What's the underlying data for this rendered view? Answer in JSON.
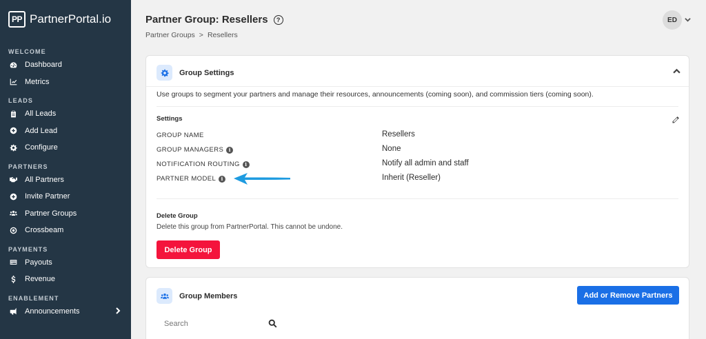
{
  "app": {
    "logo_text": "PP",
    "brand_name": "PartnerPortal.io"
  },
  "sidebar": {
    "sections": [
      {
        "label": "WELCOME",
        "items": [
          {
            "label": "Dashboard",
            "icon": "dashboard-gauge-icon"
          },
          {
            "label": "Metrics",
            "icon": "chart-line-icon"
          }
        ]
      },
      {
        "label": "LEADS",
        "items": [
          {
            "label": "All Leads",
            "icon": "clipboard-icon"
          },
          {
            "label": "Add Lead",
            "icon": "plus-circle-icon"
          },
          {
            "label": "Configure",
            "icon": "gear-icon"
          }
        ]
      },
      {
        "label": "PARTNERS",
        "items": [
          {
            "label": "All Partners",
            "icon": "handshake-icon"
          },
          {
            "label": "Invite Partner",
            "icon": "plus-circle-icon"
          },
          {
            "label": "Partner Groups",
            "icon": "users-icon"
          },
          {
            "label": "Crossbeam",
            "icon": "target-icon"
          }
        ]
      },
      {
        "label": "PAYMENTS",
        "items": [
          {
            "label": "Payouts",
            "icon": "credit-card-icon"
          },
          {
            "label": "Revenue",
            "icon": "dollar-icon"
          }
        ]
      },
      {
        "label": "ENABLEMENT",
        "items": [
          {
            "label": "Announcements",
            "icon": "megaphone-icon",
            "has_chevron": true
          }
        ]
      }
    ]
  },
  "header": {
    "title": "Partner Group: Resellers",
    "breadcrumb": [
      "Partner Groups",
      ">",
      "Resellers"
    ],
    "user_initials": "ED"
  },
  "group_settings": {
    "title": "Group Settings",
    "description": "Use groups to segment your partners and manage their resources, announcements (coming soon), and commission tiers (coming soon).",
    "settings_label": "Settings",
    "fields": [
      {
        "label": "GROUP NAME",
        "value": "Resellers",
        "has_info": false
      },
      {
        "label": "GROUP MANAGERS",
        "value": "None",
        "has_info": true
      },
      {
        "label": "NOTIFICATION ROUTING",
        "value": "Notify all admin and staff",
        "has_info": true
      },
      {
        "label": "PARTNER MODEL",
        "value": "Inherit (Reseller)",
        "has_info": true
      }
    ],
    "delete_title": "Delete Group",
    "delete_description": "Delete this group from PartnerPortal. This cannot be undone.",
    "delete_button": "Delete Group"
  },
  "group_members": {
    "title": "Group Members",
    "add_remove_button": "Add or Remove Partners",
    "search_placeholder": "Search"
  },
  "colors": {
    "sidebar_bg": "#243645",
    "accent_blue": "#1a6fe6",
    "danger_red": "#f4143c",
    "annotation_arrow": "#1e9be0"
  }
}
